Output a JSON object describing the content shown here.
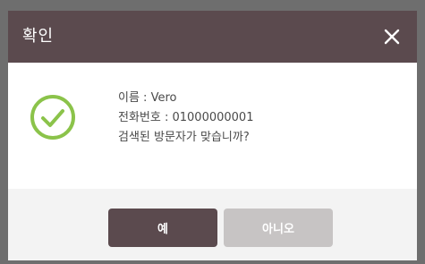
{
  "dialog": {
    "title": "확인",
    "close_icon": "close-icon",
    "status_icon": "check-circle-icon",
    "message": {
      "name_line": "이름 : Vero",
      "phone_line": "전화번호 : 01000000001",
      "question_line": "검색된 방문자가 맞습니까?"
    },
    "buttons": {
      "yes_label": "예",
      "no_label": "아니오"
    }
  },
  "colors": {
    "title_bar": "#5b4a4e",
    "check_icon": "#8bc34a",
    "yes_button": "#5b4a4e",
    "no_button": "#c7c4c4",
    "footer": "#f3f3f3"
  }
}
